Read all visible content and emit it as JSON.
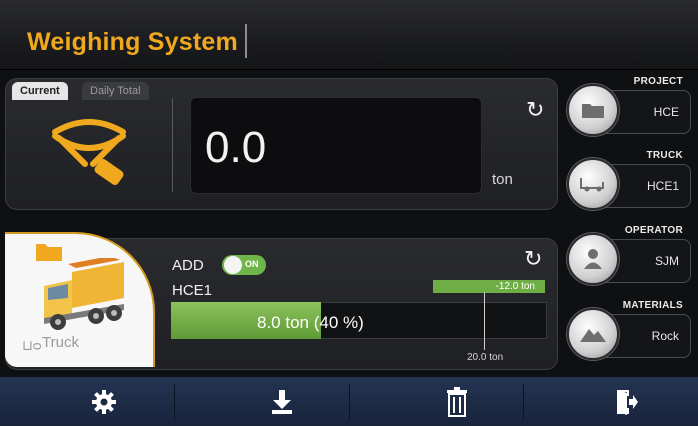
{
  "header": {
    "title": "Weighing System"
  },
  "tabs": [
    {
      "label": "Current"
    },
    {
      "label": "Daily Total"
    }
  ],
  "scale": {
    "value": "0.0",
    "unit": "ton"
  },
  "truck_panel": {
    "caption": "Truck",
    "add_label": "ADD",
    "add_toggle_state": "ON",
    "truck_id": "HCE1",
    "load_text": "8.0 ton (40 %)",
    "load_fraction": 0.4,
    "diff_text": "-12.0 ton",
    "target_text": "20.0 ton"
  },
  "side": [
    {
      "title": "PROJECT",
      "value": "HCE",
      "icon": "folder-icon"
    },
    {
      "title": "TRUCK",
      "value": "HCE1",
      "icon": "truck-icon"
    },
    {
      "title": "OPERATOR",
      "value": "SJM",
      "icon": "user-icon"
    },
    {
      "title": "MATERIALS",
      "value": "Rock",
      "icon": "mountain-icon"
    }
  ],
  "toolbar": [
    {
      "icon": "gear-icon"
    },
    {
      "icon": "download-icon"
    },
    {
      "icon": "trash-icon"
    },
    {
      "icon": "exit-icon"
    }
  ],
  "colors": {
    "accent": "#f0a91e",
    "progress": "#6fae45",
    "toolbar": "#1d2a45"
  }
}
